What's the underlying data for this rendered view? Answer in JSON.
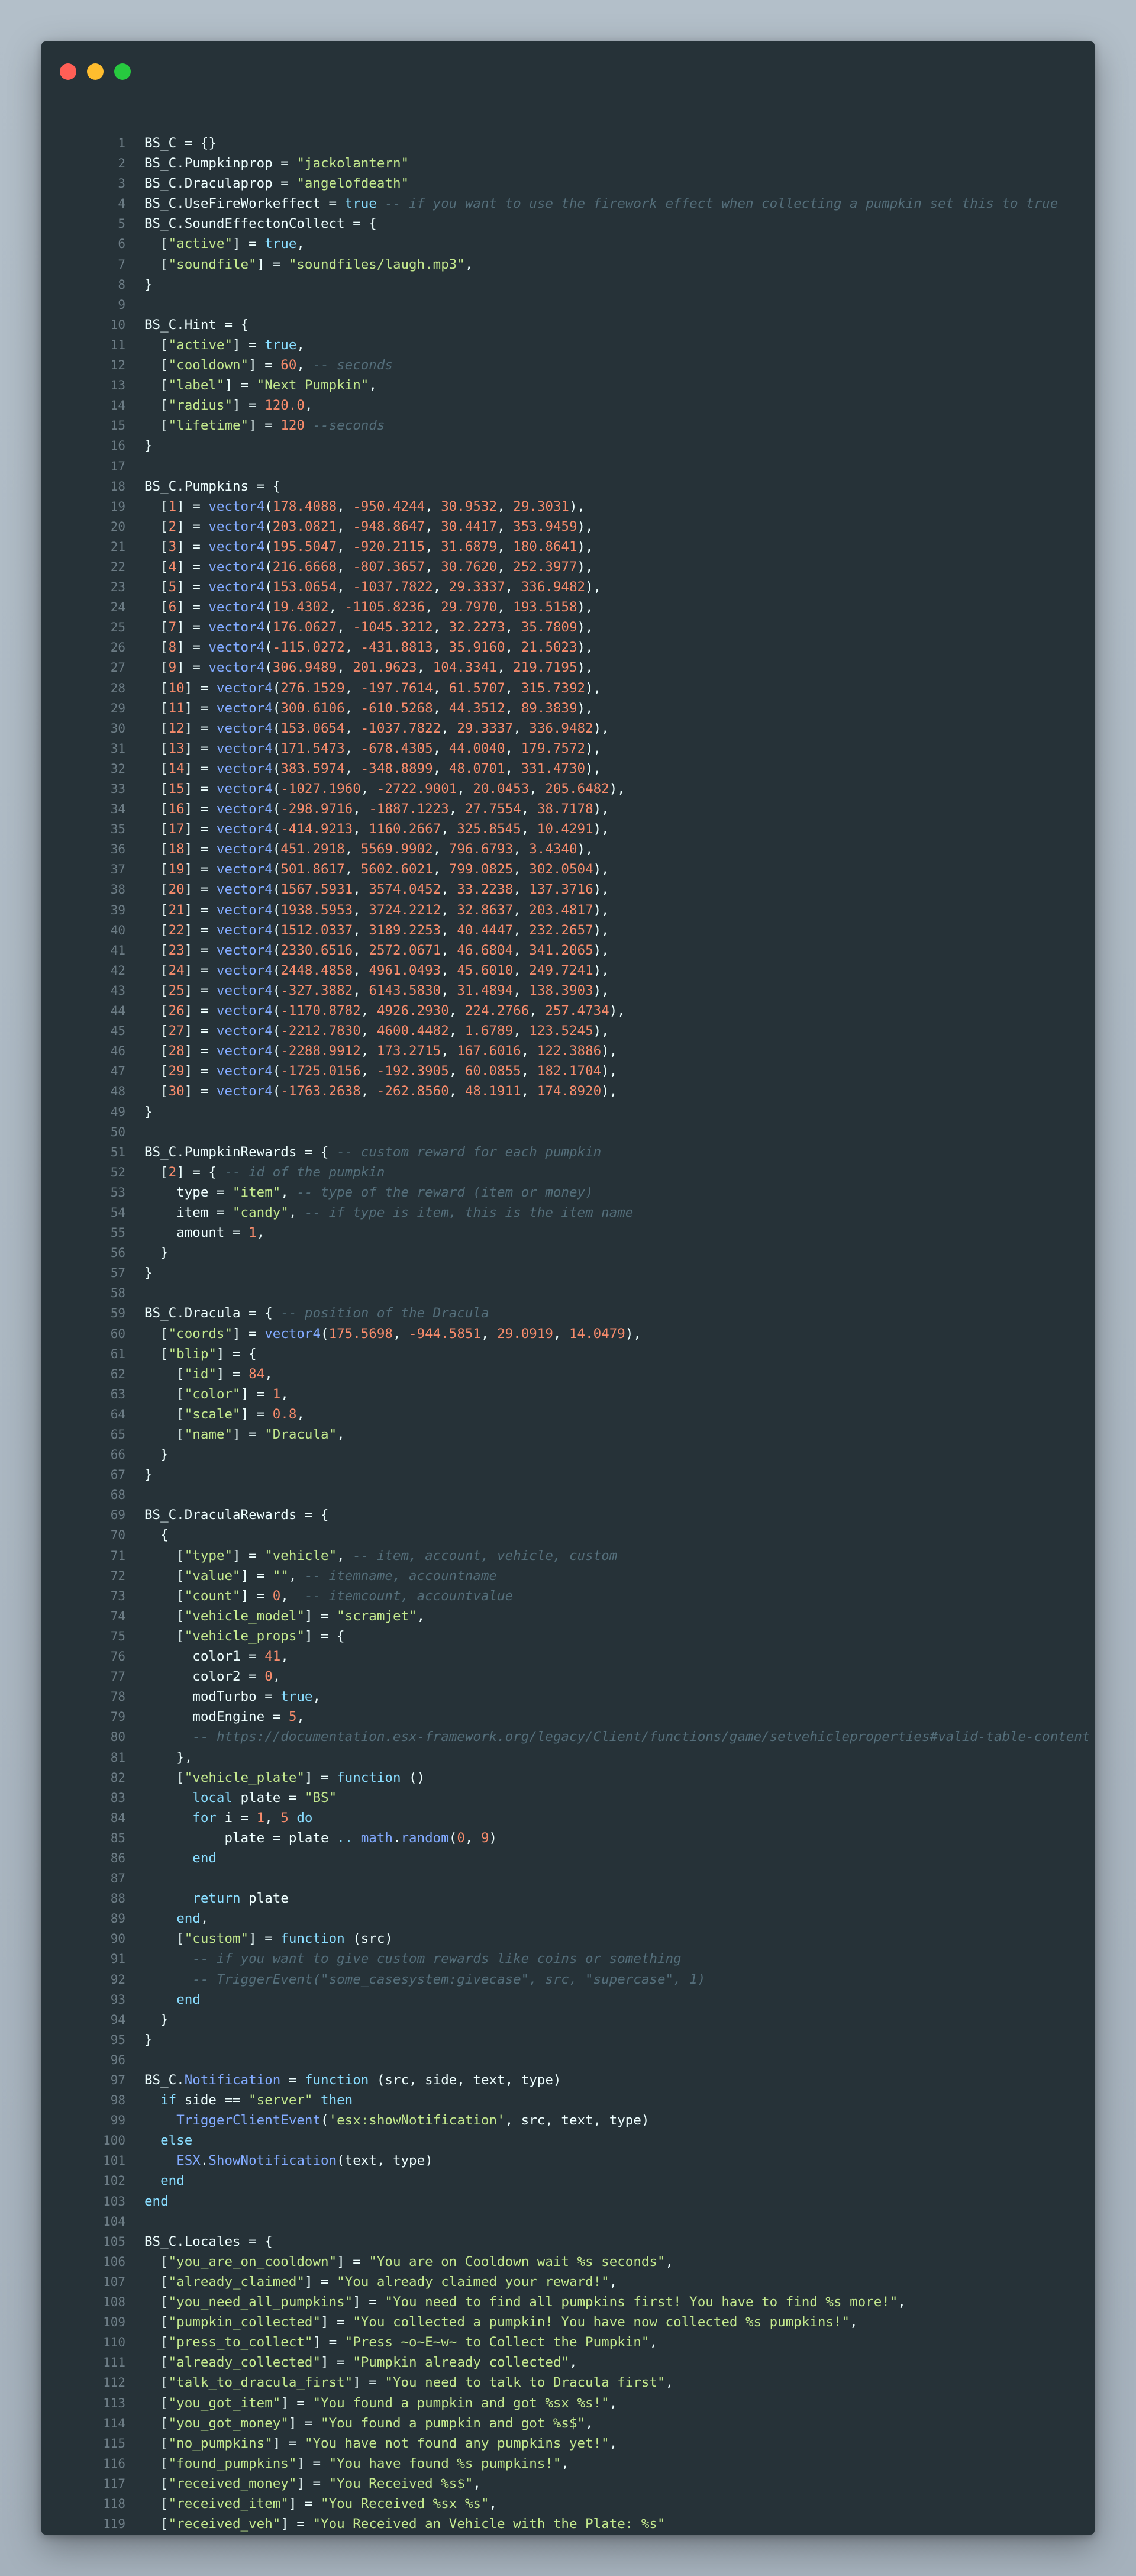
{
  "window": {
    "controls": [
      "close",
      "minimize",
      "maximize"
    ],
    "colors": {
      "background": "#263238",
      "close": "#ff5f56",
      "minimize": "#ffbd2e",
      "maximize": "#27c93f"
    }
  },
  "editor": {
    "language": "lua",
    "syntax_colors": {
      "keyword": "#89ddff",
      "string": "#c3e88d",
      "number": "#f78c6c",
      "comment": "#546e7a",
      "function": "#82aaff",
      "default": "#eeffff"
    },
    "lines": [
      "BS_C = {}",
      "BS_C.Pumpkinprop = \"jackolantern\"",
      "BS_C.Draculaprop = \"angelofdeath\"",
      "BS_C.UseFireWorkeffect = true -- if you want to use the firework effect when collecting a pumpkin set this to true",
      "BS_C.SoundEffectonCollect = {",
      "  [\"active\"] = true,",
      "  [\"soundfile\"] = \"soundfiles/laugh.mp3\",",
      "}",
      "",
      "BS_C.Hint = {",
      "  [\"active\"] = true,",
      "  [\"cooldown\"] = 60, -- seconds",
      "  [\"label\"] = \"Next Pumpkin\",",
      "  [\"radius\"] = 120.0,",
      "  [\"lifetime\"] = 120 --seconds",
      "}",
      "",
      "BS_C.Pumpkins = {",
      "  [1] = vector4(178.4088, -950.4244, 30.9532, 29.3031),",
      "  [2] = vector4(203.0821, -948.8647, 30.4417, 353.9459),",
      "  [3] = vector4(195.5047, -920.2115, 31.6879, 180.8641),",
      "  [4] = vector4(216.6668, -807.3657, 30.7620, 252.3977),",
      "  [5] = vector4(153.0654, -1037.7822, 29.3337, 336.9482),",
      "  [6] = vector4(19.4302, -1105.8236, 29.7970, 193.5158),",
      "  [7] = vector4(176.0627, -1045.3212, 32.2273, 35.7809),",
      "  [8] = vector4(-115.0272, -431.8813, 35.9160, 21.5023),",
      "  [9] = vector4(306.9489, 201.9623, 104.3341, 219.7195),",
      "  [10] = vector4(276.1529, -197.7614, 61.5707, 315.7392),",
      "  [11] = vector4(300.6106, -610.5268, 44.3512, 89.3839),",
      "  [12] = vector4(153.0654, -1037.7822, 29.3337, 336.9482),",
      "  [13] = vector4(171.5473, -678.4305, 44.0040, 179.7572),",
      "  [14] = vector4(383.5974, -348.8899, 48.0701, 331.4730),",
      "  [15] = vector4(-1027.1960, -2722.9001, 20.0453, 205.6482),",
      "  [16] = vector4(-298.9716, -1887.1223, 27.7554, 38.7178),",
      "  [17] = vector4(-414.9213, 1160.2667, 325.8545, 10.4291),",
      "  [18] = vector4(451.2918, 5569.9902, 796.6793, 3.4340),",
      "  [19] = vector4(501.8617, 5602.6021, 799.0825, 302.0504),",
      "  [20] = vector4(1567.5931, 3574.0452, 33.2238, 137.3716),",
      "  [21] = vector4(1938.5953, 3724.2212, 32.8637, 203.4817),",
      "  [22] = vector4(1512.0337, 3189.2253, 40.4447, 232.2657),",
      "  [23] = vector4(2330.6516, 2572.0671, 46.6804, 341.2065),",
      "  [24] = vector4(2448.4858, 4961.0493, 45.6010, 249.7241),",
      "  [25] = vector4(-327.3882, 6143.5830, 31.4894, 138.3903),",
      "  [26] = vector4(-1170.8782, 4926.2930, 224.2766, 257.4734),",
      "  [27] = vector4(-2212.7830, 4600.4482, 1.6789, 123.5245),",
      "  [28] = vector4(-2288.9912, 173.2715, 167.6016, 122.3886),",
      "  [29] = vector4(-1725.0156, -192.3905, 60.0855, 182.1704),",
      "  [30] = vector4(-1763.2638, -262.8560, 48.1911, 174.8920),",
      "}",
      "",
      "BS_C.PumpkinRewards = { -- custom reward for each pumpkin",
      "  [2] = { -- id of the pumpkin",
      "    type = \"item\", -- type of the reward (item or money)",
      "    item = \"candy\", -- if type is item, this is the item name",
      "    amount = 1,",
      "  }",
      "}",
      "",
      "BS_C.Dracula = { -- position of the Dracula",
      "  [\"coords\"] = vector4(175.5698, -944.5851, 29.0919, 14.0479),",
      "  [\"blip\"] = {",
      "    [\"id\"] = 84,",
      "    [\"color\"] = 1,",
      "    [\"scale\"] = 0.8,",
      "    [\"name\"] = \"Dracula\",",
      "  }",
      "}",
      "",
      "BS_C.DraculaRewards = {",
      "  {",
      "    [\"type\"] = \"vehicle\", -- item, account, vehicle, custom",
      "    [\"value\"] = \"\", -- itemname, accountname",
      "    [\"count\"] = 0,  -- itemcount, accountvalue",
      "    [\"vehicle_model\"] = \"scramjet\",",
      "    [\"vehicle_props\"] = {",
      "      color1 = 41,",
      "      color2 = 0,",
      "      modTurbo = true,",
      "      modEngine = 5,",
      "      -- https://documentation.esx-framework.org/legacy/Client/functions/game/setvehicleproperties#valid-table-content",
      "    },",
      "    [\"vehicle_plate\"] = function ()",
      "      local plate = \"BS\"",
      "      for i = 1, 5 do",
      "          plate = plate .. math.random(0, 9)",
      "      end",
      "",
      "      return plate",
      "    end,",
      "    [\"custom\"] = function (src)",
      "      -- if you want to give custom rewards like coins or something",
      "      -- TriggerEvent(\"some_casesystem:givecase\", src, \"supercase\", 1)",
      "    end",
      "  }",
      "}",
      "",
      "BS_C.Notification = function (src, side, text, type)",
      "  if side == \"server\" then",
      "    TriggerClientEvent('esx:showNotification', src, text, type)",
      "  else",
      "    ESX.ShowNotification(text, type)",
      "  end",
      "end",
      "",
      "BS_C.Locales = {",
      "  [\"you_are_on_cooldown\"] = \"You are on Cooldown wait %s seconds\",",
      "  [\"already_claimed\"] = \"You already claimed your reward!\",",
      "  [\"you_need_all_pumpkins\"] = \"You need to find all pumpkins first! You have to find %s more!\",",
      "  [\"pumpkin_collected\"] = \"You collected a pumpkin! You have now collected %s pumpkins!\",",
      "  [\"press_to_collect\"] = \"Press ~o~E~w~ to Collect the Pumpkin\",",
      "  [\"already_collected\"] = \"Pumpkin already collected\",",
      "  [\"talk_to_dracula_first\"] = \"You need to talk to Dracula first\",",
      "  [\"you_got_item\"] = \"You found a pumpkin and got %sx %s!\",",
      "  [\"you_got_money\"] = \"You found a pumpkin and got %s$\",",
      "  [\"no_pumpkins\"] = \"You have not found any pumpkins yet!\",",
      "  [\"found_pumpkins\"] = \"You have found %s pumpkins!\",",
      "  [\"received_money\"] = \"You Received %s$\",",
      "  [\"received_item\"] = \"You Received %sx %s\",",
      "  [\"received_veh\"] = \"You Received an Vehicle with the Plate: %s\"",
      "}"
    ]
  }
}
